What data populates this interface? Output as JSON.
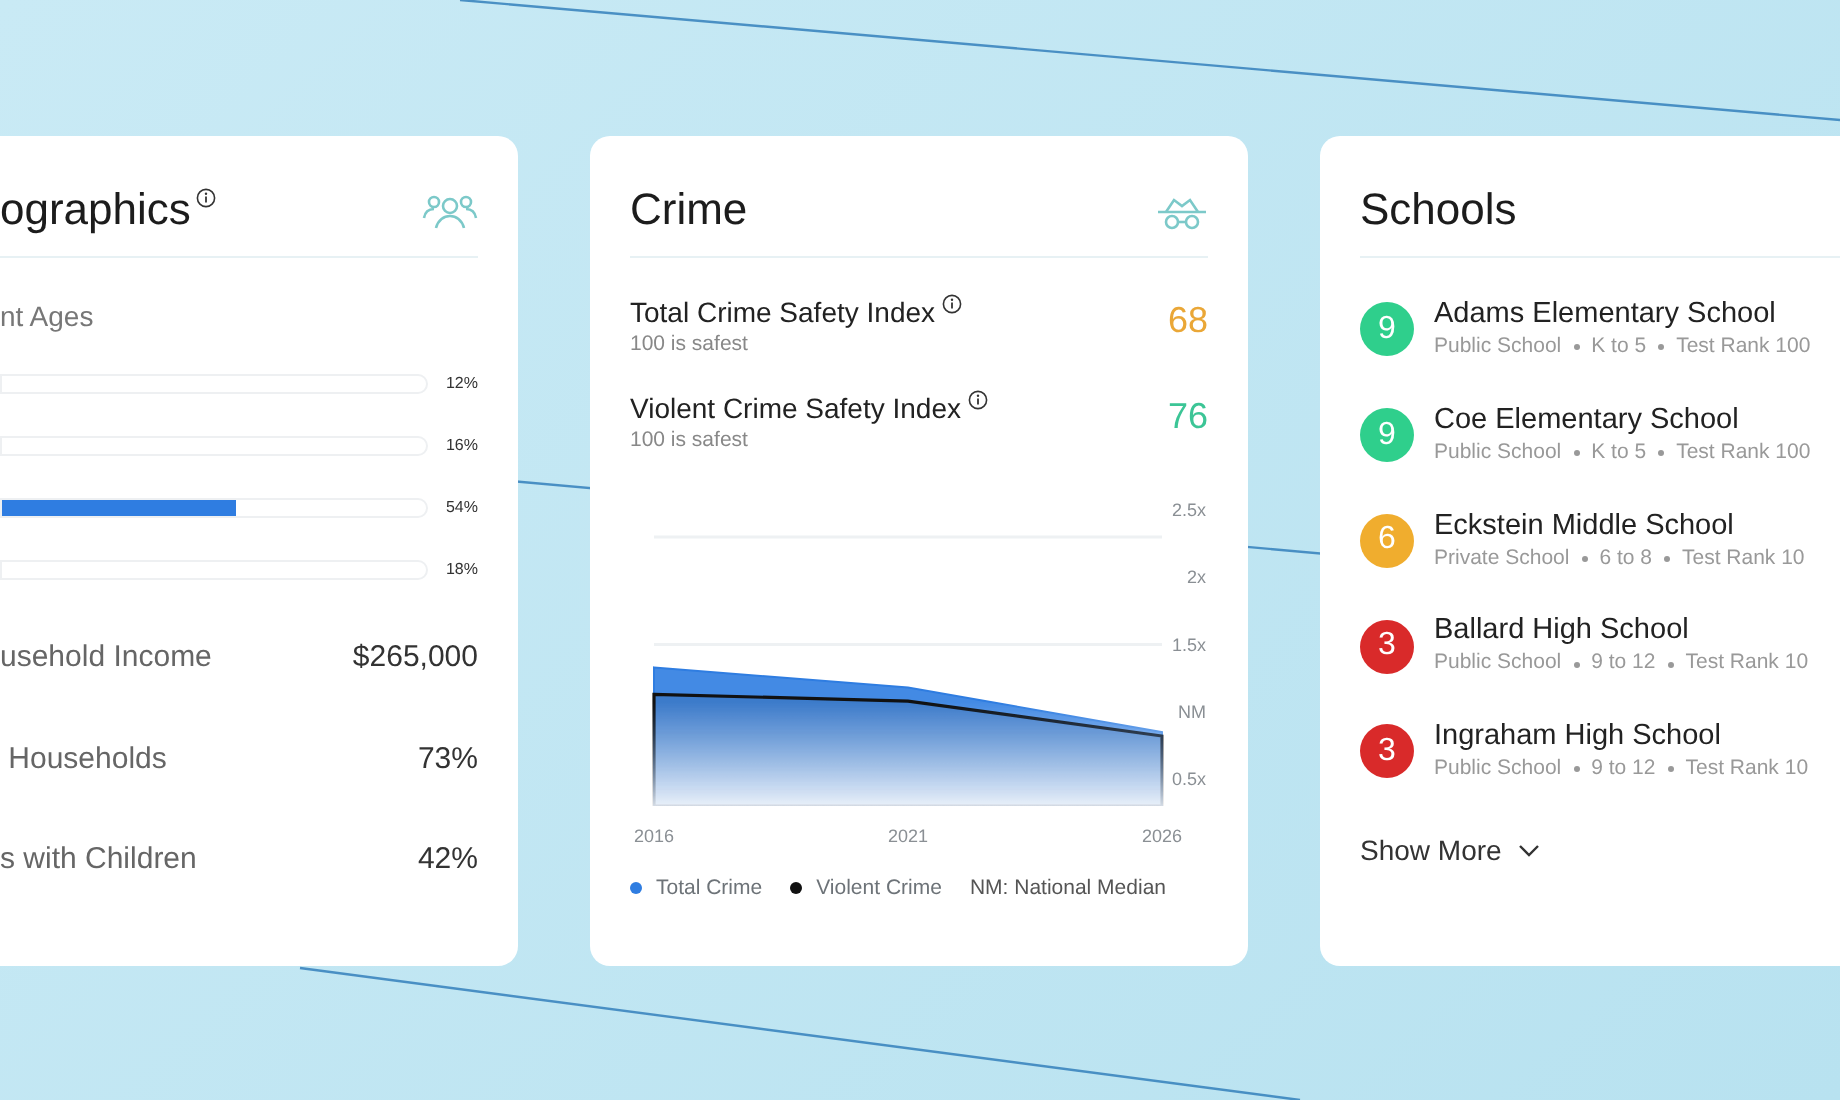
{
  "demographics": {
    "title": "ographics",
    "age_heading": "nt Ages",
    "age_bars": [
      {
        "reading": "12%"
      },
      {
        "reading": "16%"
      },
      {
        "level": 0.55,
        "reading": "54%"
      },
      {
        "reading": "18%"
      }
    ],
    "stats": [
      {
        "label": "usehold Income",
        "value": "$265,000"
      },
      {
        "label": " Households",
        "value": "73%"
      },
      {
        "label": "s with Children",
        "value": "42%"
      }
    ]
  },
  "crime": {
    "title": "Crime",
    "indexes": [
      {
        "label": "Total Crime Safety Index",
        "note": "100 is safest",
        "value": "68",
        "color": "#eaa737"
      },
      {
        "label": "Violent Crime Safety Index",
        "note": "100 is safest",
        "value": "76",
        "color": "#3cc596"
      }
    ],
    "chart_data": {
      "type": "area",
      "categories": [
        "2016",
        "2021",
        "2026"
      ],
      "series": [
        {
          "name": "Total Crime",
          "color": "#2f7de1",
          "values": [
            1.33,
            1.18,
            0.85
          ]
        },
        {
          "name": "Violent Crime",
          "color": "#111111",
          "values": [
            1.13,
            1.08,
            0.82
          ]
        }
      ],
      "ylim": [
        0.3,
        2.5
      ],
      "legend": "bottom",
      "yticks": [
        {
          "value": 2.5,
          "label": "2.5x"
        },
        {
          "value": 2,
          "label": "2x"
        },
        {
          "value": 1.5,
          "label": "1.5x"
        },
        {
          "value": 1,
          "label": "NM"
        },
        {
          "value": 0.5,
          "label": "0.5x"
        }
      ],
      "annotations": [
        {
          "text": "NM: National Median"
        }
      ]
    }
  },
  "schools": {
    "title": "Schools",
    "items": [
      {
        "rating": "9",
        "color": "#2fcf8c",
        "name": "Adams Elementary School",
        "type": "Public School",
        "grades": "K to 5",
        "rank": "Test Rank 100"
      },
      {
        "rating": "9",
        "color": "#2fcf8c",
        "name": "Coe Elementary School",
        "type": "Public School",
        "grades": "K to 5",
        "rank": "Test Rank 100"
      },
      {
        "rating": "6",
        "color": "#f0ad2e",
        "name": "Eckstein Middle School",
        "type": "Private School",
        "grades": "6 to 8",
        "rank": "Test Rank 10"
      },
      {
        "rating": "3",
        "color": "#d92a2a",
        "name": "Ballard High School",
        "type": "Public School",
        "grades": "9 to 12",
        "rank": "Test Rank 10"
      },
      {
        "rating": "3",
        "color": "#d92a2a",
        "name": "Ingraham High School",
        "type": "Public School",
        "grades": "9 to 12",
        "rank": "Test Rank 10"
      }
    ],
    "show_more": "Show More"
  }
}
